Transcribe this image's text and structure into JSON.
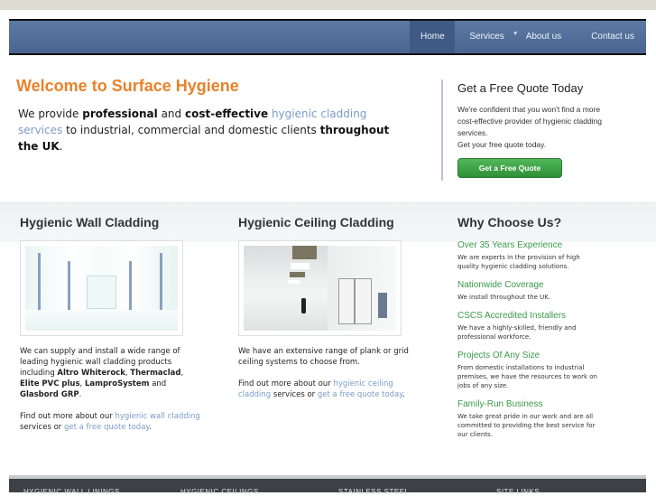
{
  "nav": {
    "items": [
      {
        "label": "Home",
        "active": true
      },
      {
        "label": "Services",
        "has_dropdown": true
      },
      {
        "label": "About us"
      },
      {
        "label": "Contact us"
      }
    ]
  },
  "welcome": {
    "title": "Welcome to Surface Hygiene",
    "intro": {
      "t1": "We provide ",
      "b1": "professional",
      "t2": " and ",
      "b2": "cost-effective",
      "t3": " ",
      "link": "hygienic cladding services",
      "t4": " to industrial, commercial and domestic clients ",
      "b3": "throughout the UK",
      "t5": "."
    }
  },
  "quote": {
    "title": "Get a Free Quote Today",
    "text1": "We're confident that you won't find a more cost-effective provider of hygienic cladding services.",
    "text2": "Get your free quote today.",
    "button": "Get a Free Quote",
    "button_color": "#3fa84a"
  },
  "columns": {
    "wall": {
      "title": "Hygienic Wall Cladding",
      "p1": {
        "t1": "We can supply and install a wide range of leading hygienic wall cladding products including ",
        "b1": "Altro Whiterock",
        "t2": ", ",
        "b2": "Thermaclad",
        "t3": ", ",
        "b3": "Elite PVC plus",
        "t4": ", ",
        "b4": "LamproSystem",
        "t5": " and ",
        "b5": "Glasbord GRP",
        "t6": "."
      },
      "p2": {
        "t1": "Find out more about our ",
        "link1": "hygienic wall cladding",
        "t2": " services or ",
        "link2": "get a free quote today",
        "t3": "."
      }
    },
    "ceiling": {
      "title": "Hygienic Ceiling Cladding",
      "p1": "We have an extensive range of plank or grid ceiling systems to choose from.",
      "p2": {
        "t1": "Find out more about our ",
        "link1": "hygienic ceiling cladding",
        "t2": " services or ",
        "link2": "get a free quote today",
        "t3": "."
      }
    },
    "why": {
      "title": "Why Choose Us?",
      "items": [
        {
          "heading": "Over 35 Years Experience",
          "text": "We are experts in the provision of high quality hygienic cladding solutions."
        },
        {
          "heading": "Nationwide Coverage",
          "text": "We install throughout the UK."
        },
        {
          "heading": "CSCS Accredited Installers",
          "text": "We have a highly-skilled, friendly and professional workforce."
        },
        {
          "heading": "Projects Of Any Size",
          "text": "From domestic installations to industrial premises, we have the resources to work on jobs of any size."
        },
        {
          "heading": "Family-Run Business",
          "text": "We take great pride in our work and are all committed to providing the best service for our clients."
        }
      ]
    }
  },
  "footer": {
    "columns": [
      "HYGIENIC WALL LININGS",
      "HYGIENIC CEILINGS",
      "STAINLESS STEEL",
      "SITE LINKS"
    ]
  },
  "colors": {
    "accent_orange": "#e8822a",
    "nav_blue": "#4f6b96",
    "link_blue": "#7a9cc6",
    "green": "#3a9a4a"
  }
}
